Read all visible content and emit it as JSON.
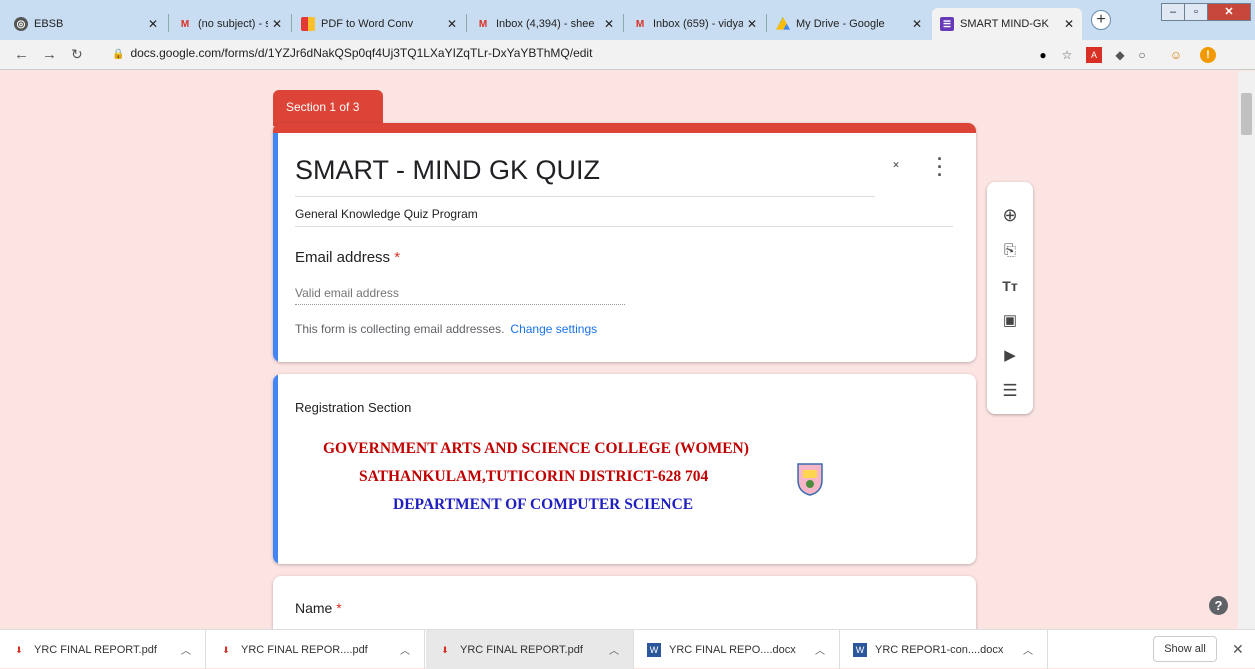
{
  "tabs": [
    {
      "title": "EBSB",
      "icon": "globe-icon",
      "active": false
    },
    {
      "title": "(no subject) - sheel",
      "icon": "gmail-icon",
      "active": false
    },
    {
      "title": "PDF to Word Conv",
      "icon": "pdf-converter-icon",
      "active": false
    },
    {
      "title": "Inbox (4,394) - shee",
      "icon": "gmail-icon",
      "active": false
    },
    {
      "title": "Inbox (659) - vidya",
      "icon": "gmail-icon",
      "active": false
    },
    {
      "title": "My Drive - Google",
      "icon": "drive-icon",
      "active": false
    },
    {
      "title": "SMART MIND-GK",
      "icon": "forms-icon",
      "active": true
    }
  ],
  "address": {
    "url": "docs.google.com/forms/d/1YZJr6dNakQSp0qf4Uj3TQ1LXaYIZqTLr-DxYaYBThMQ/edit"
  },
  "form": {
    "section_label": "Section 1 of 3",
    "title": "SMART - MIND GK QUIZ",
    "description": "General  Knowledge Quiz Program",
    "email_label": "Email address",
    "email_placeholder": "Valid email address",
    "collecting_text": "This form is collecting email addresses.",
    "change_settings": "Change settings",
    "section_title": "Registration Section",
    "college": {
      "line1": "GOVERNMENT ARTS AND SCIENCE COLLEGE (WOMEN)",
      "line2": "SATHANKULAM,TUTICORIN DISTRICT-628 704",
      "line3": "DEPARTMENT OF COMPUTER SCIENCE"
    },
    "name_label": "Name",
    "required_mark": "*"
  },
  "toolbar": [
    "add-question-icon",
    "import-questions-icon",
    "add-title-icon",
    "add-image-icon",
    "add-video-icon",
    "add-section-icon"
  ],
  "downloads": [
    {
      "name": "YRC FINAL REPORT.pdf",
      "type": "pdf"
    },
    {
      "name": "YRC FINAL REPOR....pdf",
      "type": "pdf"
    },
    {
      "name": "YRC FINAL REPORT.pdf",
      "type": "pdf"
    },
    {
      "name": "YRC FINAL REPO....docx",
      "type": "docx"
    },
    {
      "name": "YRC REPOR1-con....docx",
      "type": "docx"
    }
  ],
  "show_all": "Show all",
  "colors": {
    "accent": "#db4437",
    "blue": "#4285f4",
    "background": "#fce4e3"
  }
}
